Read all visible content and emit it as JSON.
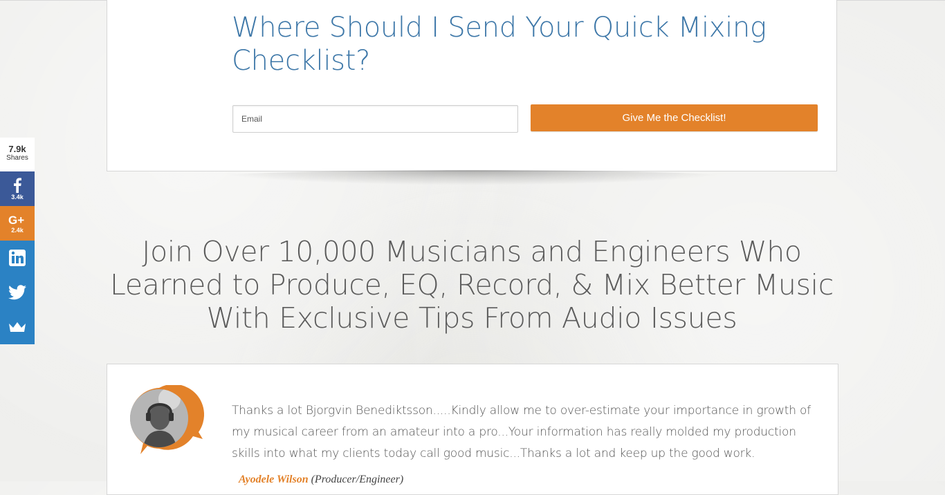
{
  "optin": {
    "title": "Where Should I Send Your Quick Mixing Checklist?",
    "email_placeholder": "Email",
    "button_label": "Give Me the Checklist!"
  },
  "share_bar": {
    "total": "7.9k",
    "total_label": "Shares",
    "facebook_count": "3.4k",
    "googleplus_count": "2.4k",
    "icons": [
      "facebook-icon",
      "google-plus-icon",
      "linkedin-icon",
      "twitter-icon",
      "crown-icon"
    ]
  },
  "heading": {
    "text": "Join Over 10,000 Musicians and Engineers Who Learned to Produce, EQ, Record, & Mix Better Music With Exclusive Tips From Audio Issues"
  },
  "testimonial": {
    "text": "Thanks a lot Bjorgvin Benediktsson.....Kindly allow me to over-estimate your importance in growth of my musical career from an amateur into a pro...Your information has really molded my production skills into what my clients today call good music...Thanks a lot and keep up the good work.",
    "author_name": "Ayodele Wilson",
    "author_role": "(Producer/Engineer)"
  },
  "colors": {
    "accent_orange": "#e3822a",
    "title_blue": "#3d77a8",
    "facebook_blue": "#3b5998",
    "share_blue": "#2b82c4"
  }
}
